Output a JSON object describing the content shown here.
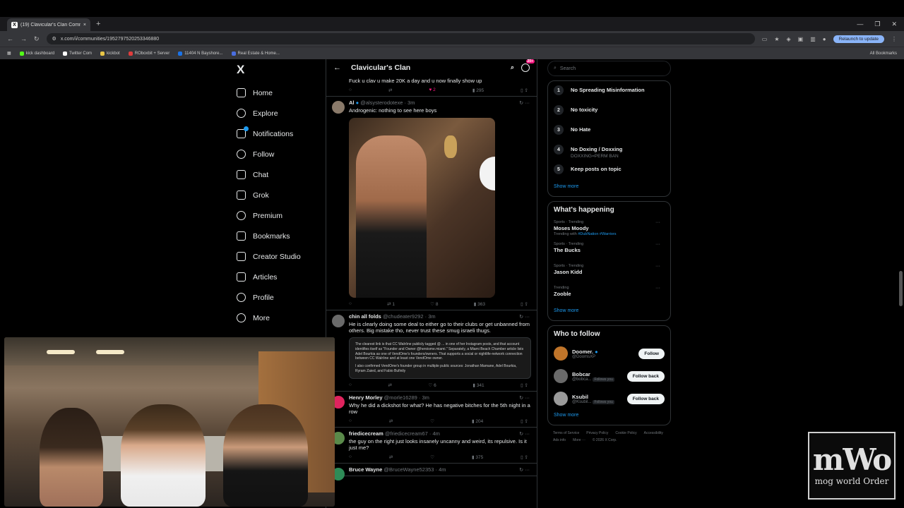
{
  "browser": {
    "tab_title": "(19) Clavicular's Clan Commun...",
    "new_tab": "+",
    "url": "x.com/i/communities/1952797520253346880",
    "relaunch_label": "Relaunch to update",
    "bookmarks": [
      {
        "label": "kick dashboard",
        "color": "#53fc18"
      },
      {
        "label": "Twitter Com",
        "color": "#ffffff"
      },
      {
        "label": "kickbot",
        "color": "#e8c547"
      },
      {
        "label": "ROboxbit + Server",
        "color": "#e03d3d"
      },
      {
        "label": "11404 N Bayshore...",
        "color": "#1a73e8"
      },
      {
        "label": "Real Estate & Home...",
        "color": "#4a6ee0"
      }
    ],
    "all_bookmarks": "All Bookmarks"
  },
  "sidebar": {
    "logo": "X",
    "items": [
      {
        "label": "Home",
        "icon": "home-icon"
      },
      {
        "label": "Explore",
        "icon": "search-icon"
      },
      {
        "label": "Notifications",
        "icon": "bell-icon"
      },
      {
        "label": "Follow",
        "icon": "follow-icon"
      },
      {
        "label": "Chat",
        "icon": "mail-icon"
      },
      {
        "label": "Grok",
        "icon": "grok-icon"
      },
      {
        "label": "Premium",
        "icon": "premium-icon"
      },
      {
        "label": "Bookmarks",
        "icon": "bookmark-icon"
      },
      {
        "label": "Creator Studio",
        "icon": "lightning-icon"
      },
      {
        "label": "Articles",
        "icon": "article-icon"
      },
      {
        "label": "Profile",
        "icon": "profile-icon"
      },
      {
        "label": "More",
        "icon": "more-icon"
      }
    ]
  },
  "feed": {
    "title": "Clavicular's Clan",
    "notif_count": "20+",
    "posts": [
      {
        "name": "",
        "handle": "",
        "body": "Fuck u clav u make 20K a day and u now finally show up",
        "replies": "",
        "reposts": "",
        "likes": "2",
        "views": "295",
        "liked": true
      },
      {
        "name": "Al",
        "handle": "@alsysterodotexe · 3m",
        "body": "Androgenic: nothing to see here boys",
        "replies": "",
        "reposts": "1",
        "likes": "8",
        "views": "363",
        "liked": false
      },
      {
        "name": "chin all folds",
        "handle": "@chudeater9292 · 3m",
        "body": "He is clearly doing some deal to either go to their clubs or get unbanned from others. Big mistake tho, never trust these smug israeli thugs.",
        "quote_1": "The clearest link is that CC Walrōne publicly tagged @ ... in one of her Instagram posts, and that account identifies itself as \"Founder and Owner @heroisme.miami.\" Separately, a Miami Beach Chamber article lists Adel Bourkia as one of VendOme's founders/owners. That supports a social or nightlife-network connection between CC Walrōne and at least one VendOme owner.",
        "quote_2": "I also confirmed VendOme's founder group in multiple public sources: Jonathan Mamane, Adel Bourkia, Ryram Zaied, and Fabio Bufinily",
        "replies": "",
        "reposts": "",
        "likes": "6",
        "views": "341",
        "liked": false
      },
      {
        "name": "Henry Morley",
        "handle": "@morle16289 · 3m",
        "body": "Why he did a dickshot for what? He has negative bitches for the 5th night in a row",
        "replies": "",
        "reposts": "",
        "likes": "",
        "views": "204",
        "liked": false
      },
      {
        "name": "friedicecream",
        "handle": "@friedicecream67 · 4m",
        "body": "the guy on the right just looks insanely uncanny and weird, its repulsive. Is it just me?",
        "replies": "",
        "reposts": "",
        "likes": "",
        "views": "375",
        "liked": false
      },
      {
        "name": "Bruce Wayne",
        "handle": "@BruceWayne52353 · 4m",
        "body": "",
        "replies": "",
        "reposts": "",
        "likes": "",
        "views": "",
        "liked": false
      }
    ]
  },
  "right": {
    "search_placeholder": "Search",
    "rules": [
      {
        "num": "1",
        "title": "No Spreading Misinformation",
        "sub": ""
      },
      {
        "num": "2",
        "title": "No toxicity",
        "sub": ""
      },
      {
        "num": "3",
        "title": "No Hate",
        "sub": ""
      },
      {
        "num": "4",
        "title": "No Doxing / Doxxing",
        "sub": "DOXXING=PERM BAN"
      },
      {
        "num": "5",
        "title": "Keep posts on topic",
        "sub": ""
      }
    ],
    "show_more": "Show more",
    "happening_title": "What's happening",
    "trends": [
      {
        "cat": "Sports · Trending",
        "name": "Moses Moody",
        "sub_prefix": "Trending with ",
        "sub_tags": "#DubNation  #Warriors"
      },
      {
        "cat": "Sports · Trending",
        "name": "The Bucks",
        "sub_prefix": "",
        "sub_tags": ""
      },
      {
        "cat": "Sports · Trending",
        "name": "Jason Kidd",
        "sub_prefix": "",
        "sub_tags": ""
      },
      {
        "cat": "Trending",
        "name": "Zooble",
        "sub_prefix": "",
        "sub_tags": ""
      }
    ],
    "who_title": "Who to follow",
    "who": [
      {
        "name": "Doomer.",
        "handle": "@DoomsXP",
        "follows_you": "",
        "button": "Follow",
        "color": "#c0752a"
      },
      {
        "name": "Bobcar",
        "handle": "@bobca...",
        "follows_you": "Follows you",
        "button": "Follow back",
        "color": "#6a6a6a"
      },
      {
        "name": "Ksubil",
        "handle": "@Ksubil...",
        "follows_you": "Follows you",
        "button": "Follow back",
        "color": "#9a9a9a"
      }
    ],
    "footer": [
      "Terms of Service",
      "Privacy Policy",
      "Cookie Policy",
      "Accessibility",
      "Ads info",
      "More ···",
      "© 2026 X Corp."
    ]
  },
  "overlay": {
    "logo_big": "mWo",
    "logo_small": "mog world Order"
  }
}
